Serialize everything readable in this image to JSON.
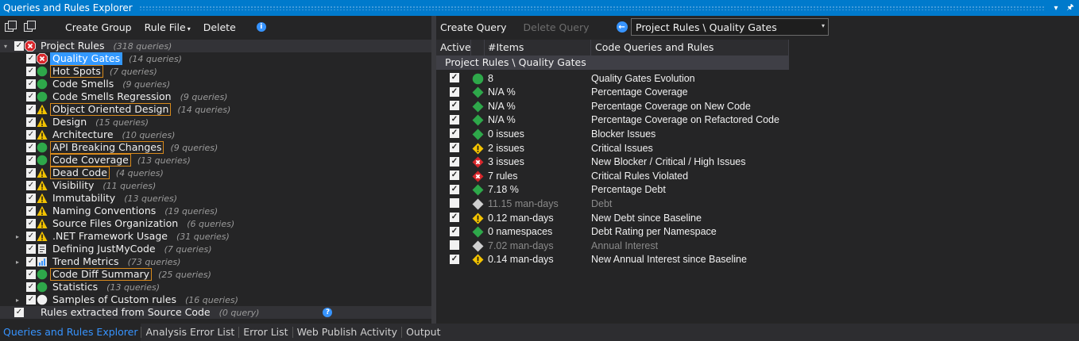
{
  "window": {
    "title": "Queries and Rules Explorer",
    "pin_icon": "pin-icon",
    "dropdown_icon": "dropdown-icon"
  },
  "left_toolbar": {
    "create_group": "Create Group",
    "rule_file": "Rule File",
    "delete": "Delete"
  },
  "tree": {
    "root": {
      "label": "Project Rules",
      "count": "(318 queries)"
    },
    "items": [
      {
        "label": "Quality Gates",
        "count": "(14 queries)",
        "icon": "error",
        "state": "selected"
      },
      {
        "label": "Hot Spots",
        "count": "(7 queries)",
        "icon": "ok",
        "state": "highlighted"
      },
      {
        "label": "Code Smells",
        "count": "(9 queries)",
        "icon": "ok",
        "state": "normal"
      },
      {
        "label": "Code Smells Regression",
        "count": "(9 queries)",
        "icon": "ok",
        "state": "normal"
      },
      {
        "label": "Object Oriented Design",
        "count": "(14 queries)",
        "icon": "warning",
        "state": "highlighted"
      },
      {
        "label": "Design",
        "count": "(15 queries)",
        "icon": "warning",
        "state": "normal"
      },
      {
        "label": "Architecture",
        "count": "(10 queries)",
        "icon": "warning",
        "state": "normal"
      },
      {
        "label": "API Breaking Changes",
        "count": "(9 queries)",
        "icon": "ok",
        "state": "highlighted"
      },
      {
        "label": "Code Coverage",
        "count": "(13 queries)",
        "icon": "ok",
        "state": "highlighted"
      },
      {
        "label": "Dead Code",
        "count": "(4 queries)",
        "icon": "warning",
        "state": "highlighted"
      },
      {
        "label": "Visibility",
        "count": "(11 queries)",
        "icon": "warning",
        "state": "normal"
      },
      {
        "label": "Immutability",
        "count": "(13 queries)",
        "icon": "warning",
        "state": "normal"
      },
      {
        "label": "Naming Conventions",
        "count": "(19 queries)",
        "icon": "warning",
        "state": "normal"
      },
      {
        "label": "Source Files Organization",
        "count": "(6 queries)",
        "icon": "warning",
        "state": "normal"
      },
      {
        "label": ".NET Framework Usage",
        "count": "(31 queries)",
        "icon": "warning",
        "state": "normal"
      },
      {
        "label": "Defining JustMyCode",
        "count": "(7 queries)",
        "icon": "code-file",
        "state": "normal"
      },
      {
        "label": "Trend Metrics",
        "count": "(73 queries)",
        "icon": "trend",
        "state": "normal"
      },
      {
        "label": "Code Diff Summary",
        "count": "(25 queries)",
        "icon": "ok",
        "state": "highlighted"
      },
      {
        "label": "Statistics",
        "count": "(13 queries)",
        "icon": "ok",
        "state": "normal"
      },
      {
        "label": "Samples of Custom rules",
        "count": "(16 queries)",
        "icon": "info-white",
        "state": "normal"
      }
    ],
    "extracted": {
      "label": "Rules extracted from Source Code",
      "count": "(0 query)"
    }
  },
  "right_toolbar": {
    "create_query": "Create Query",
    "delete_query": "Delete Query",
    "path": "Project Rules \\ Quality Gates"
  },
  "grid": {
    "headers": {
      "active": "Active",
      "items": "#Items",
      "name": "Code Queries and Rules"
    },
    "group": "Project Rules \\ Quality Gates",
    "rows": [
      {
        "checked": true,
        "icon": "ok-circle",
        "items": "8",
        "name": "Quality Gates Evolution",
        "dim": false
      },
      {
        "checked": true,
        "icon": "ok-diamond",
        "items": "N/A %",
        "name": "Percentage Coverage",
        "dim": false
      },
      {
        "checked": true,
        "icon": "ok-diamond",
        "items": "N/A %",
        "name": "Percentage Coverage on New Code",
        "dim": false
      },
      {
        "checked": true,
        "icon": "ok-diamond",
        "items": "N/A %",
        "name": "Percentage Coverage on Refactored Code",
        "dim": false
      },
      {
        "checked": true,
        "icon": "ok-diamond",
        "items": "0 issues",
        "name": "Blocker Issues",
        "dim": false
      },
      {
        "checked": true,
        "icon": "warning-diamond",
        "items": "2 issues",
        "name": "Critical Issues",
        "dim": false
      },
      {
        "checked": true,
        "icon": "error-diamond",
        "items": "3 issues",
        "name": "New Blocker / Critical / High Issues",
        "dim": false
      },
      {
        "checked": true,
        "icon": "error-diamond",
        "items": "7 rules",
        "name": "Critical Rules Violated",
        "dim": false
      },
      {
        "checked": true,
        "icon": "ok-diamond",
        "items": "7.18 %",
        "name": "Percentage Debt",
        "dim": false
      },
      {
        "checked": false,
        "icon": "grey-diamond",
        "items": "11.15 man-days",
        "name": "Debt",
        "dim": true
      },
      {
        "checked": true,
        "icon": "warning-diamond",
        "items": "0.12 man-days",
        "name": "New Debt since Baseline",
        "dim": false
      },
      {
        "checked": true,
        "icon": "ok-diamond",
        "items": "0 namespaces",
        "name": "Debt Rating per Namespace",
        "dim": false
      },
      {
        "checked": false,
        "icon": "grey-diamond",
        "items": "7.02 man-days",
        "name": "Annual Interest",
        "dim": true
      },
      {
        "checked": true,
        "icon": "warning-diamond",
        "items": "0.14 man-days",
        "name": "New Annual Interest since Baseline",
        "dim": false
      }
    ]
  },
  "bottom_tabs": [
    {
      "label": "Queries and Rules Explorer",
      "active": true
    },
    {
      "label": "Analysis Error List",
      "active": false
    },
    {
      "label": "Error List",
      "active": false
    },
    {
      "label": "Web Publish Activity",
      "active": false
    },
    {
      "label": "Output",
      "active": false
    }
  ],
  "colors": {
    "accent": "#007acc",
    "ok": "#2ea84a",
    "warning": "#f3c300",
    "error": "#d9262b",
    "highlight_border": "#d88a1c",
    "selection": "#3399ff"
  }
}
